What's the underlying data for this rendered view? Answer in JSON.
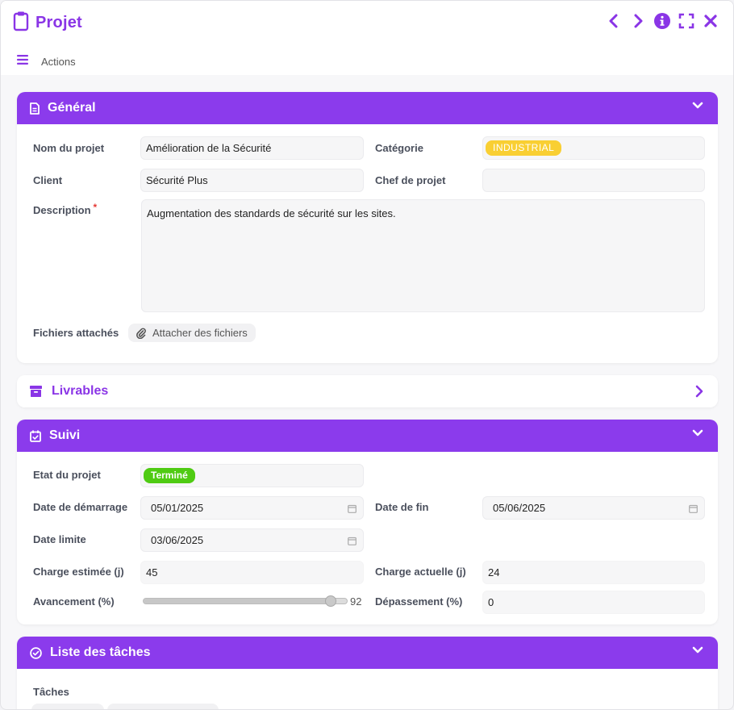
{
  "window": {
    "title": "Projet",
    "controls": [
      "previous-icon",
      "next-icon",
      "info-icon",
      "fullscreen-icon",
      "close-icon"
    ],
    "actions_label": "Actions"
  },
  "colors": {
    "accent": "#8b3bec",
    "badge_industrial": "#f9cf33",
    "badge_done": "#4fcb13",
    "required": "#e53935"
  },
  "general": {
    "title": "Général",
    "fields": {
      "nom_label": "Nom du projet",
      "nom_value": "Amélioration de la Sécurité",
      "categorie_label": "Catégorie",
      "categorie_value": "INDUSTRIAL",
      "client_label": "Client",
      "client_value": "Sécurité Plus",
      "chef_label": "Chef de projet",
      "chef_value": "",
      "description_label": "Description",
      "description_required": "*",
      "description_value": "Augmentation des standards de sécurité sur les sites.",
      "fichiers_label": "Fichiers attachés",
      "attach_button": "Attacher des fichiers"
    }
  },
  "livrables": {
    "title": "Livrables"
  },
  "suivi": {
    "title": "Suivi",
    "fields": {
      "etat_label": "Etat du projet",
      "etat_value": "Terminé",
      "debut_label": "Date de démarrage",
      "debut_value": "05/01/2025",
      "fin_label": "Date de fin",
      "fin_value": "05/06/2025",
      "limite_label": "Date limite",
      "limite_value": "03/06/2025",
      "charge_est_label": "Charge estimée (j)",
      "charge_est_value": "45",
      "charge_act_label": "Charge actuelle (j)",
      "charge_act_value": "24",
      "avancement_label": "Avancement (%)",
      "avancement_value": "92",
      "avancement_fraction": 0.92,
      "depassement_label": "Dépassement (%)",
      "depassement_value": "0"
    }
  },
  "taches": {
    "title": "Liste des tâches",
    "label": "Tâches"
  }
}
